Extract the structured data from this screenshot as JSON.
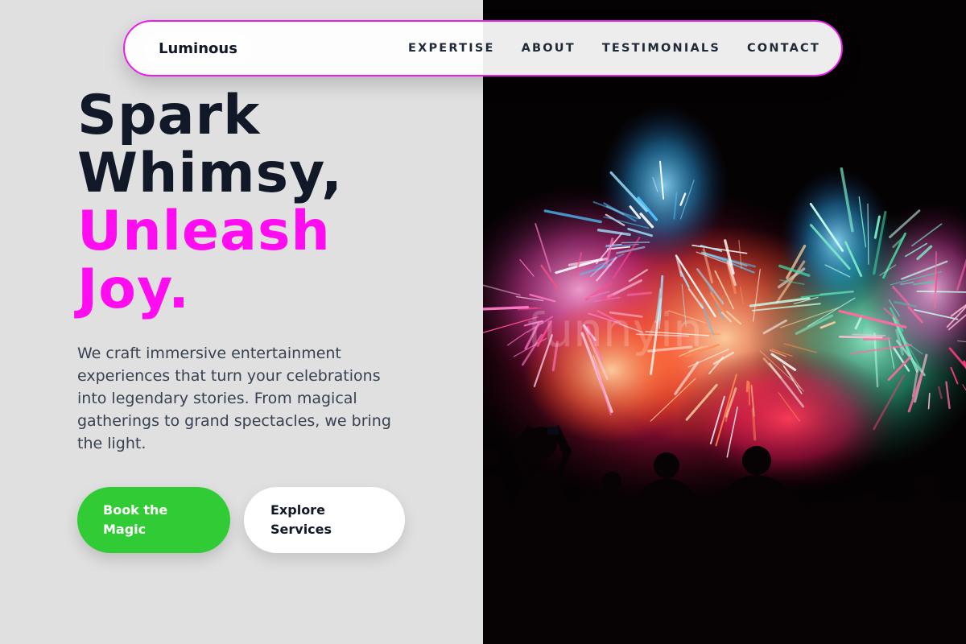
{
  "brand": {
    "name": "Luminous"
  },
  "nav": {
    "links": [
      "EXPERTISE",
      "ABOUT",
      "TESTIMONIALS",
      "CONTACT"
    ]
  },
  "hero": {
    "headline_line1": "Spark",
    "headline_line2": "Whimsy,",
    "headline_accent_line1": "Unleash",
    "headline_accent_line2": "Joy.",
    "description": "We craft immersive entertainment experiences that turn your celebrations into legendary stories. From magical gatherings to grand spectacles, we bring the light.",
    "primary_button": "Book the Magic",
    "secondary_button": "Explore Services",
    "image_watermark": "funnyin"
  },
  "colors": {
    "accent": "#ff0cf0",
    "nav_border": "#e81ee8",
    "primary_button": "#31cc35",
    "headline_dark": "#111827",
    "background": "#e0e0e0"
  }
}
